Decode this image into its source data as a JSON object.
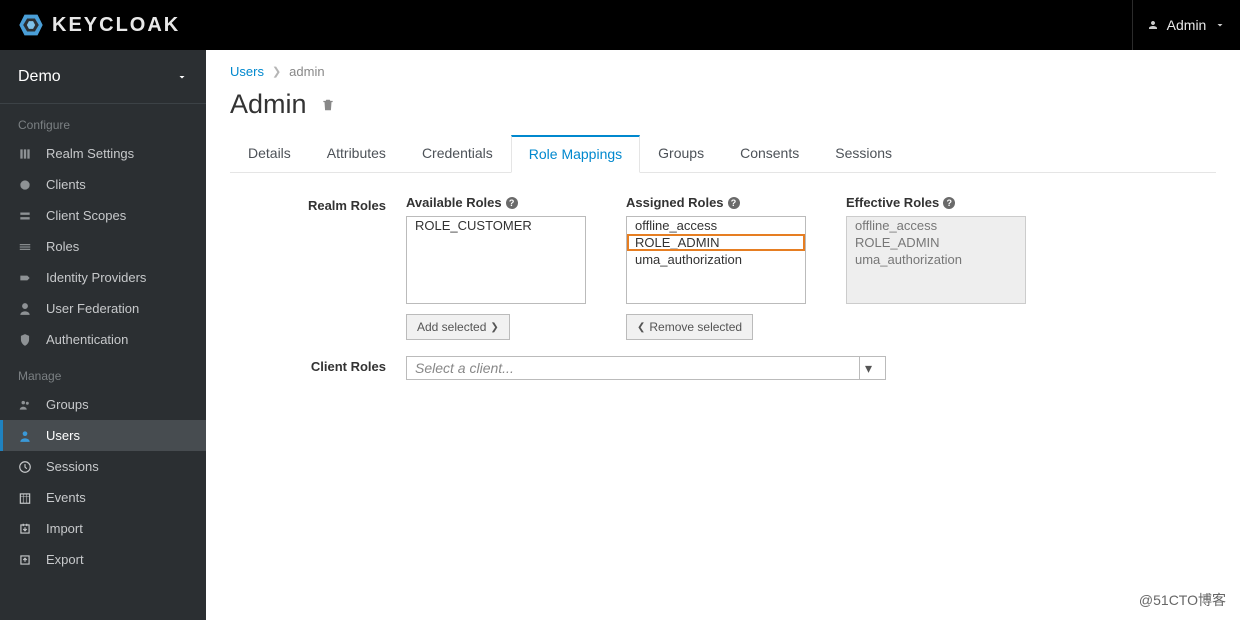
{
  "header": {
    "logo_text": "KEYCLOAK",
    "user_label": "Admin"
  },
  "sidebar": {
    "realm_selector": "Demo",
    "section_configure": "Configure",
    "section_manage": "Manage",
    "configure_items": [
      "Realm Settings",
      "Clients",
      "Client Scopes",
      "Roles",
      "Identity Providers",
      "User Federation",
      "Authentication"
    ],
    "manage_items": [
      "Groups",
      "Users",
      "Sessions",
      "Events",
      "Import",
      "Export"
    ],
    "active_manage_index": 1
  },
  "breadcrumbs": {
    "root": "Users",
    "current": "admin"
  },
  "page": {
    "title": "Admin"
  },
  "tabs": [
    "Details",
    "Attributes",
    "Credentials",
    "Role Mappings",
    "Groups",
    "Consents",
    "Sessions"
  ],
  "active_tab_index": 3,
  "role_mappings": {
    "realm_roles_label": "Realm Roles",
    "available_label": "Available Roles",
    "assigned_label": "Assigned Roles",
    "effective_label": "Effective Roles",
    "available": [
      "ROLE_CUSTOMER"
    ],
    "assigned": [
      "offline_access",
      "ROLE_ADMIN",
      "uma_authorization"
    ],
    "assigned_highlight_index": 1,
    "effective": [
      "offline_access",
      "ROLE_ADMIN",
      "uma_authorization"
    ],
    "add_selected_btn": "Add selected",
    "remove_selected_btn": "Remove selected",
    "client_roles_label": "Client Roles",
    "client_select_placeholder": "Select a client..."
  },
  "watermark": "@51CTO博客"
}
